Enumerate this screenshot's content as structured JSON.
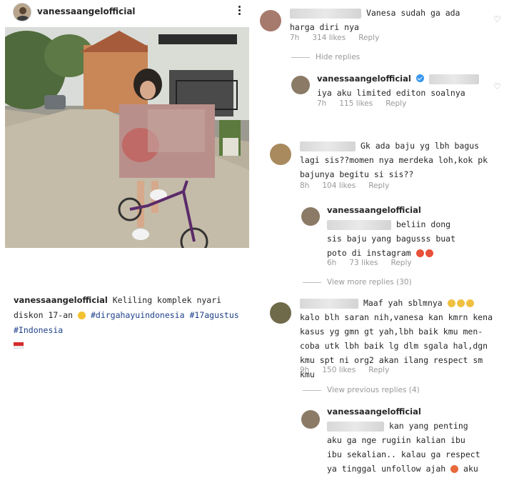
{
  "post": {
    "username": "vanessaangelofficial",
    "caption_text": "Keliling komplek nyari diskon 17-an",
    "hashtags": [
      "#dirgahayuindonesia",
      "#17agustus",
      "#Indonesia"
    ]
  },
  "comments": {
    "c1": {
      "text": "Vanesa sudah ga ada harga diri nya",
      "time": "7h",
      "likes": "314 likes",
      "reply": "Reply"
    },
    "hide_replies": "Hide replies",
    "c1r": {
      "username": "vanessaangelofficial",
      "text": "iya aku limited editon soalnya",
      "time": "7h",
      "likes": "115 likes",
      "reply": "Reply"
    },
    "c2": {
      "text": "Gk ada baju yg lbh bagus lagi sis??momen nya merdeka loh,kok pk bajunya begitu si sis??",
      "time": "8h",
      "likes": "104 likes",
      "reply": "Reply"
    },
    "c2r": {
      "username": "vanessaangelofficial",
      "text": "beliin dong sis baju yang bagusss buat poto di instagram",
      "time": "6h",
      "likes": "73 likes",
      "reply": "Reply"
    },
    "view_more": "View more replies (30)",
    "c3": {
      "text": "Maaf yah sblmnya",
      "text2": "kalo blh saran nih,vanesa kan kmrn kena kasus yg gmn gt yah,lbh baik kmu men-coba utk lbh baik lg dlm sgala hal,dgn kmu spt ni org2 akan ilang respect sm kmu",
      "time": "9h",
      "likes": "150 likes",
      "reply": "Reply"
    },
    "view_previous": "View previous replies (4)",
    "c3r": {
      "username": "vanessaangelofficial",
      "text": "kan yang penting aku ga nge rugiin kalian ibu ibu sekalian.. kalau ga respect ya tinggal unfollow ajah",
      "text_end": "aku berdoa"
    }
  },
  "colors": {
    "hashtag": "#1d3f8a",
    "meta": "#999999",
    "verified": "#3897f0"
  }
}
